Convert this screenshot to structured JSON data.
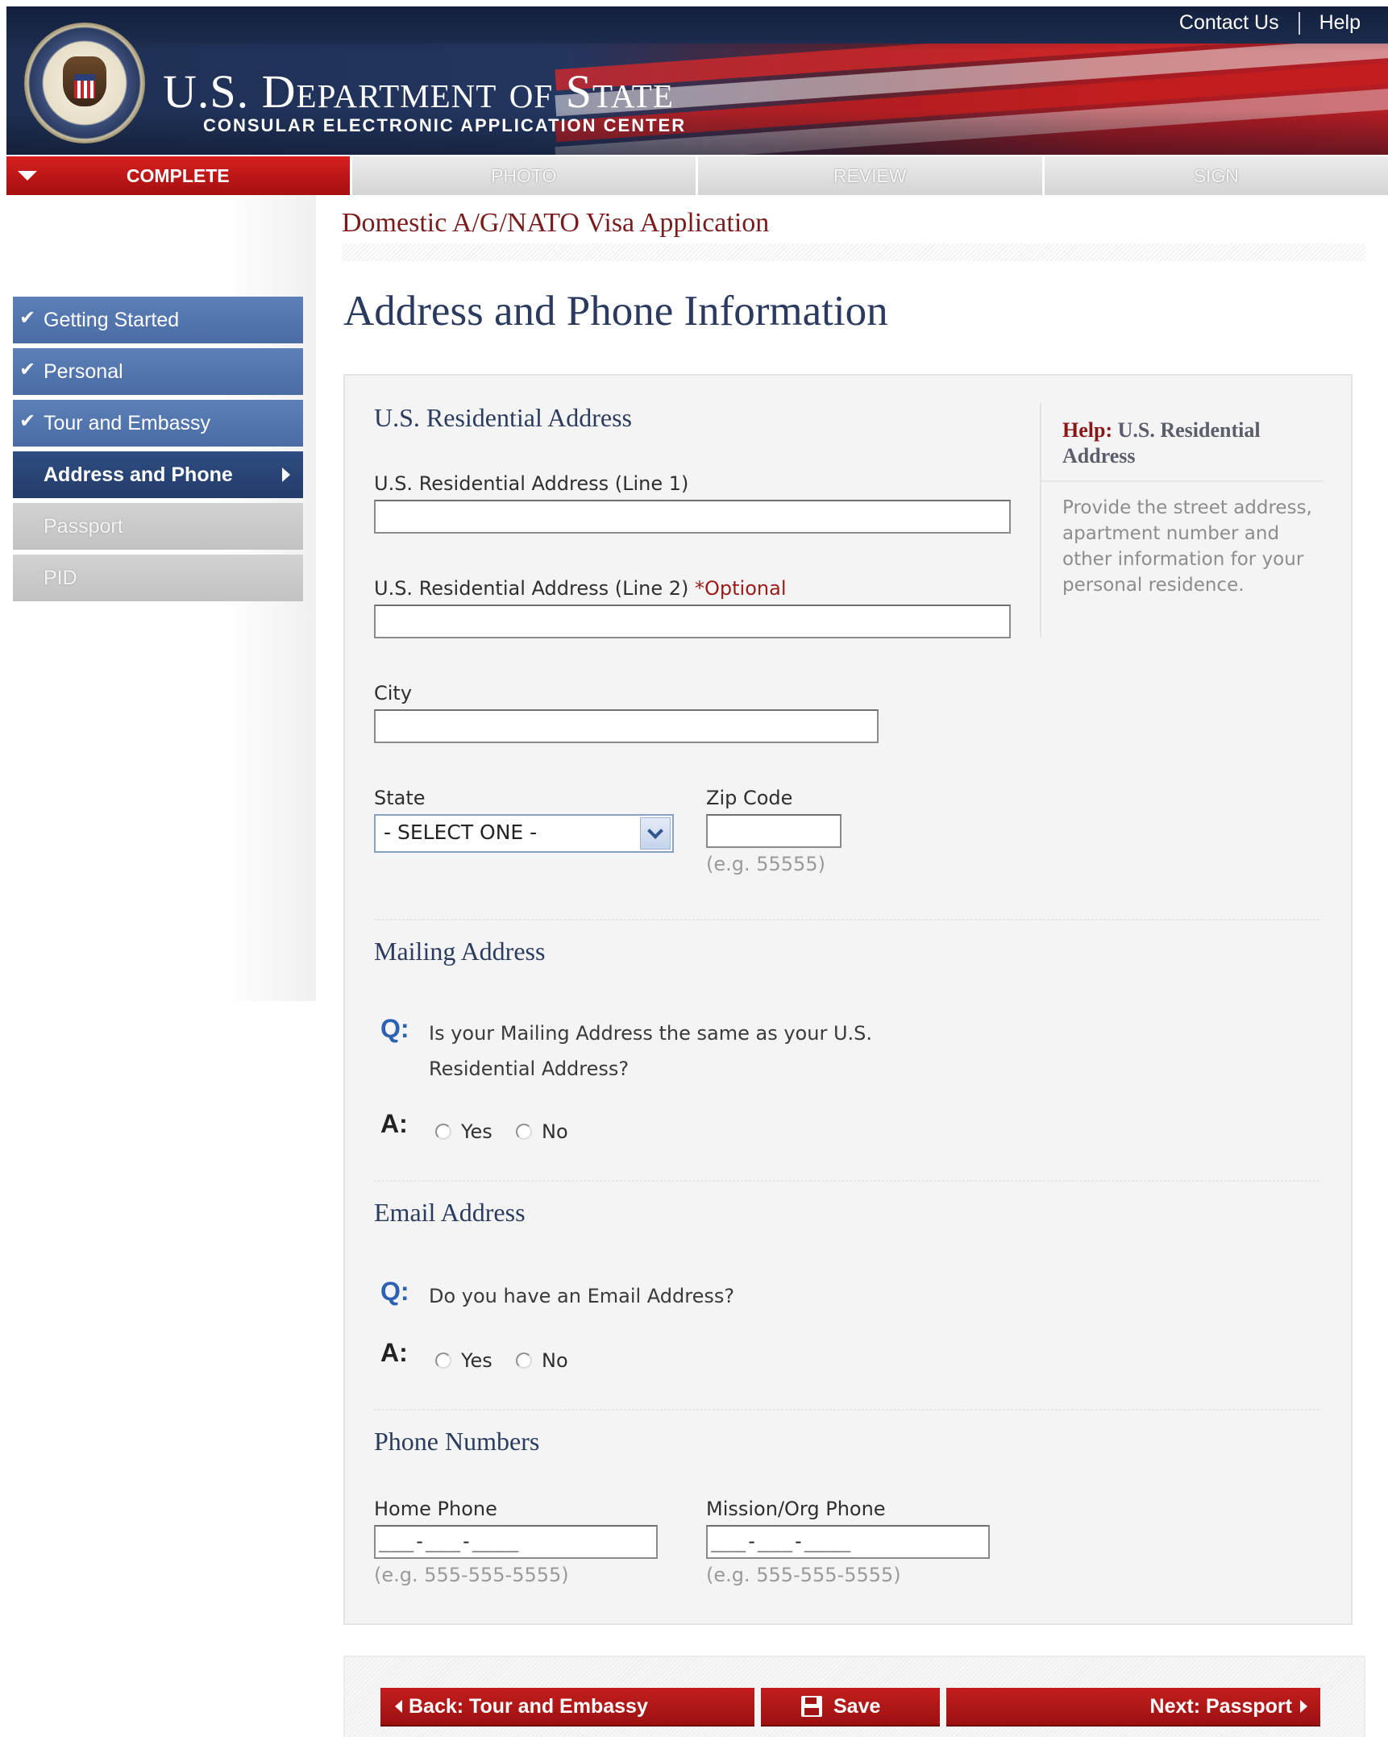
{
  "header": {
    "title": "U.S. Department of State",
    "subtitle": "CONSULAR ELECTRONIC APPLICATION CENTER",
    "links": [
      "Contact Us",
      "Help"
    ]
  },
  "steps": [
    {
      "label": "COMPLETE",
      "active": true
    },
    {
      "label": "PHOTO",
      "active": false
    },
    {
      "label": "REVIEW",
      "active": false
    },
    {
      "label": "SIGN",
      "active": false
    }
  ],
  "sidebar": {
    "items": [
      {
        "label": "Getting Started",
        "state": "done"
      },
      {
        "label": "Personal",
        "state": "done"
      },
      {
        "label": "Tour and Embassy",
        "state": "done"
      },
      {
        "label": "Address and Phone",
        "state": "current"
      },
      {
        "label": "Passport",
        "state": "todo"
      },
      {
        "label": "PID",
        "state": "todo"
      }
    ]
  },
  "main": {
    "app_title": "Domestic A/G/NATO Visa Application",
    "page_title": "Address and Phone Information",
    "residential": {
      "heading": "U.S. Residential Address",
      "line1_label": "U.S. Residential Address (Line 1)",
      "line1_value": "",
      "line2_label": "U.S. Residential Address (Line 2)",
      "line2_optional": "*Optional",
      "line2_value": "",
      "city_label": "City",
      "city_value": "",
      "state_label": "State",
      "state_value": "- SELECT ONE -",
      "zip_label": "Zip Code",
      "zip_value": "",
      "zip_hint": "(e.g. 55555)"
    },
    "mailing": {
      "heading": "Mailing Address",
      "q_mark": "Q:",
      "question_line1": "Is your Mailing Address the same as your U.S.",
      "question_line2": "Residential Address?",
      "a_mark": "A:",
      "yes": "Yes",
      "no": "No"
    },
    "email": {
      "heading": "Email Address",
      "q_mark": "Q:",
      "question": "Do you have an Email Address?",
      "a_mark": "A:",
      "yes": "Yes",
      "no": "No"
    },
    "phones": {
      "heading": "Phone Numbers",
      "home_label": "Home Phone",
      "home_mask": "___-___-____",
      "home_hint": "(e.g. 555-555-5555)",
      "mission_label": "Mission/Org Phone",
      "mission_mask": "___-___-____",
      "mission_hint": "(e.g. 555-555-5555)"
    },
    "help": {
      "prefix": "Help:",
      "title": "U.S. Residential Address",
      "body": "Provide the street address, apartment number and other information for your personal residence."
    }
  },
  "footer": {
    "back_label": "Back: Tour and Embassy",
    "save_label": "Save",
    "next_label": "Next: Passport"
  },
  "colors": {
    "brand_red": "#b61d24",
    "nav_blue": "#4a6ba3",
    "nav_current": "#233c69",
    "heading_navy": "#2a3b5f"
  }
}
